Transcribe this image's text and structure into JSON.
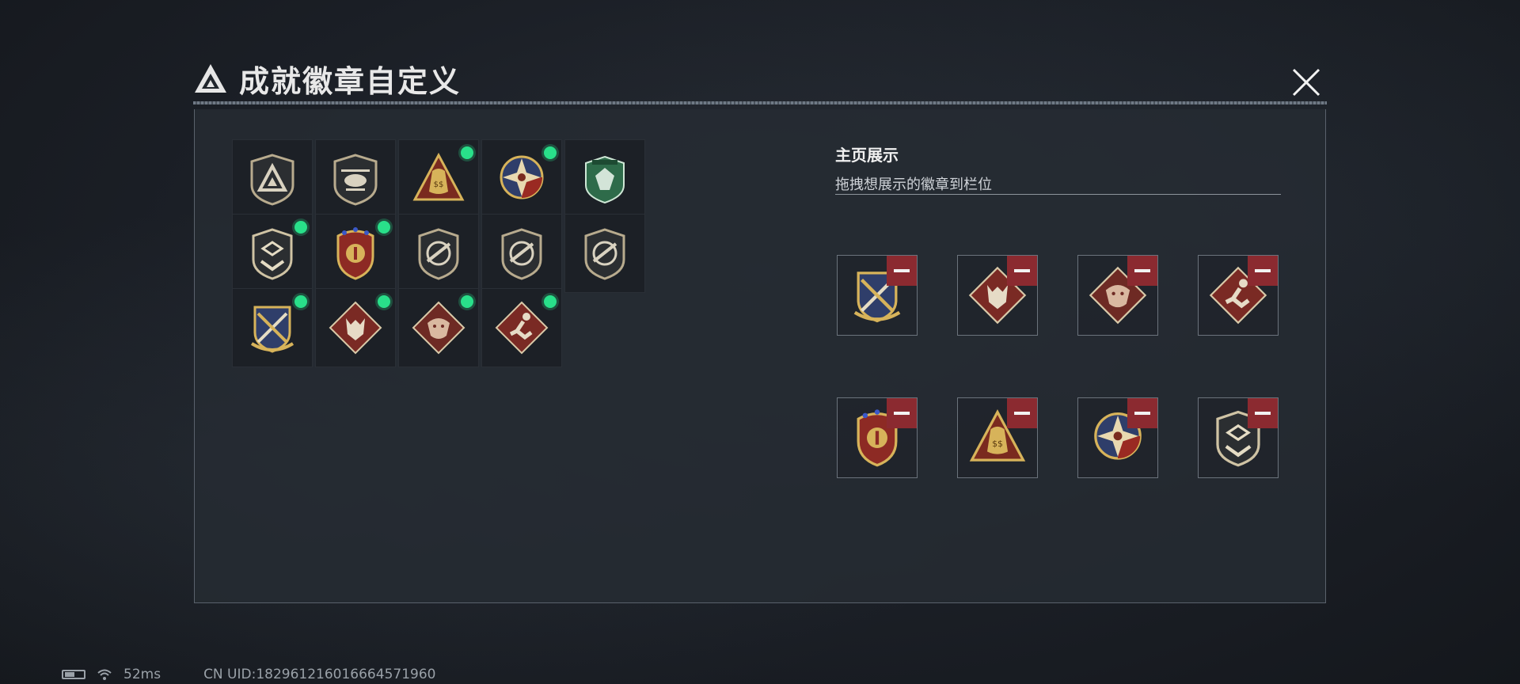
{
  "header": {
    "title": "成就徽章自定义"
  },
  "showcase": {
    "title": "主页展示",
    "subtitle": "拖拽想展示的徽章到栏位"
  },
  "badges": [
    {
      "type": "tri-shield",
      "selected": false
    },
    {
      "type": "heli-shield",
      "selected": false
    },
    {
      "type": "moneybag",
      "selected": true
    },
    {
      "type": "star-compass",
      "selected": true
    },
    {
      "type": "green-gem",
      "selected": false
    },
    {
      "type": "chevron-shield",
      "selected": true
    },
    {
      "type": "eagle-crest",
      "selected": true
    },
    {
      "type": "gun-shield",
      "selected": false
    },
    {
      "type": "gun-shield",
      "selected": false
    },
    {
      "type": "gun-shield",
      "selected": false
    },
    {
      "type": "crossed-blades",
      "selected": true
    },
    {
      "type": "wolf-diamond",
      "selected": true
    },
    {
      "type": "dragon-diamond",
      "selected": true
    },
    {
      "type": "runner-diamond",
      "selected": true
    }
  ],
  "slots": [
    {
      "type": "crossed-blades"
    },
    {
      "type": "wolf-diamond"
    },
    {
      "type": "dragon-diamond"
    },
    {
      "type": "runner-diamond"
    },
    {
      "type": "eagle-crest"
    },
    {
      "type": "moneybag"
    },
    {
      "type": "star-compass"
    },
    {
      "type": "chevron-shield"
    }
  ],
  "status": {
    "ping": "52ms",
    "uid": "CN UID:182961216016664571960"
  },
  "colors": {
    "accent_green": "#29e08a",
    "remove_red": "#8b2a30",
    "panel": "#262b32"
  }
}
